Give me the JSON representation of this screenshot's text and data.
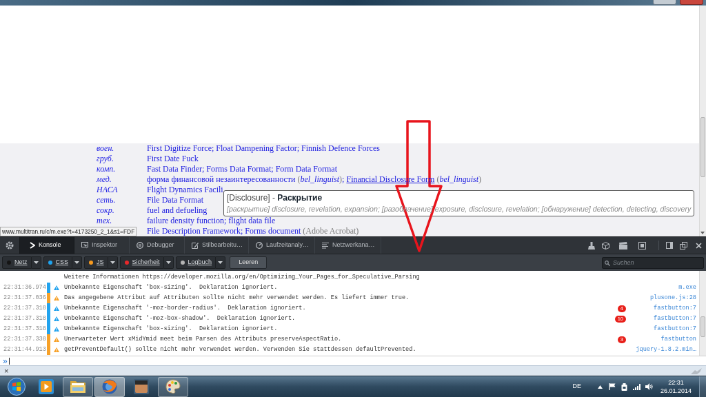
{
  "page": {
    "rows": [
      {
        "subject": "воен.",
        "translation": [
          {
            "kind": "term",
            "text": "First Digitize Force; Float Dampening Factor; Finnish Defence Forces"
          }
        ]
      },
      {
        "subject": "груб.",
        "translation": [
          {
            "kind": "term",
            "text": "First Date Fuck"
          }
        ]
      },
      {
        "subject": "комп.",
        "translation": [
          {
            "kind": "term",
            "text": "Fast Data Finder; Forms Data Format; Form Data Format"
          }
        ]
      },
      {
        "subject": "мед.",
        "translation": [
          {
            "kind": "term",
            "text": "форма финансовой незаинтересованности"
          },
          {
            "kind": "author",
            "text": "(*bel_linguist*)"
          },
          {
            "kind": "sep",
            "text": ";"
          },
          {
            "kind": "link",
            "text": "Financial Disclosure Form"
          },
          {
            "kind": "author",
            "text": "(*bel_linguist*)"
          }
        ]
      },
      {
        "subject": "НАСА",
        "translation": [
          {
            "kind": "term",
            "text": "Flight Dynamics Facili"
          }
        ]
      },
      {
        "subject": "сеть.",
        "translation": [
          {
            "kind": "term",
            "text": "File Data Format"
          }
        ]
      },
      {
        "subject": "сокр.",
        "translation": [
          {
            "kind": "term",
            "text": "fuel and defueling"
          }
        ]
      },
      {
        "subject": "тех.",
        "translation": [
          {
            "kind": "term",
            "text": "failure density function; flight data file"
          }
        ]
      },
      {
        "translation": [
          {
            "kind": "term",
            "text": "File Description Framework; Forms document"
          },
          {
            "kind": "note",
            "text": "(Adobe Acrobat)"
          }
        ]
      }
    ],
    "status_url": "www.multitran.ru/c/m.exe?t=4173250_2_1&s1=FDF"
  },
  "tooltip": {
    "title": "[Disclosure] - **Раскрытие**",
    "details": "[раскрытие] disclosure, revelation, expansion; [разоблачение] exposure, disclosure, revelation; [обнаружение] detection, detecting, discovery"
  },
  "devtools": {
    "tabs": [
      {
        "label": "Konsole",
        "selected": true
      },
      {
        "label": "Inspektor",
        "selected": false
      },
      {
        "label": "Debugger",
        "selected": false
      },
      {
        "label": "Stilbearbeitu…",
        "selected": false
      },
      {
        "label": "Laufzeitanaly…",
        "selected": false
      },
      {
        "label": "Netzwerkana…",
        "selected": false
      }
    ],
    "filters": [
      {
        "label": "Netz",
        "color": "#151515"
      },
      {
        "label": "CSS",
        "color": "#1ea4f0"
      },
      {
        "label": "JS",
        "color": "#f79a1e"
      },
      {
        "label": "Sicherheit",
        "color": "#e8282a"
      },
      {
        "label": "Logbuch",
        "color": "#b4b4b4"
      }
    ],
    "clear_button": "Leeren",
    "search": {
      "placeholder": "Suchen"
    },
    "messages": [
      {
        "kind": "continuation",
        "text": "Weitere Informationen https://developer.mozilla.org/en/Optimizing_Your_Pages_for_Speculative_Parsing"
      },
      {
        "kind": "css",
        "time": "22:31:36.974",
        "text": "Unbekannte Eigenschaft 'box-sizing'.  Deklaration ignoriert.",
        "source": "m.exe"
      },
      {
        "kind": "js",
        "time": "22:31:37.036",
        "text": "Das angegebene Attribut auf Attributen sollte nicht mehr verwendet werden. Es liefert immer true.",
        "source": "plusone.js:28"
      },
      {
        "kind": "css",
        "time": "22:31:37.318",
        "text": "Unbekannte Eigenschaft '-moz-border-radius'.  Deklaration ignoriert.",
        "count": "4",
        "source": "fastbutton:7"
      },
      {
        "kind": "css",
        "time": "22:31:37.318",
        "text": "Unbekannte Eigenschaft '-moz-box-shadow'.  Deklaration ignoriert.",
        "count": "10",
        "source": "fastbutton:7"
      },
      {
        "kind": "css",
        "time": "22:31:37.318",
        "text": "Unbekannte Eigenschaft 'box-sizing'.  Deklaration ignoriert.",
        "source": "fastbutton:7"
      },
      {
        "kind": "js",
        "time": "22:31:37.338",
        "text": "Unerwarteter Wert xMidYmid meet beim Parsen des Attributs preserveAspectRatio.",
        "count": "3",
        "source": "fastbutton"
      },
      {
        "kind": "js",
        "time": "22:31:44.913",
        "text": "getPreventDefault() sollte nicht mehr verwendet werden. Verwenden Sie stattdessen defaultPrevented.",
        "source": "jquery-1.8.2.min…"
      }
    ],
    "prompt": "»"
  },
  "addon_bar": {
    "close": "×"
  },
  "taskbar": {
    "tasks": [
      {
        "open": false,
        "selected": false
      },
      {
        "open": true,
        "selected": false
      },
      {
        "open": true,
        "selected": true
      },
      {
        "open": false,
        "selected": false
      },
      {
        "open": true,
        "selected": false
      }
    ],
    "language": "DE",
    "time": "22:31",
    "date": "26.01.2014"
  }
}
